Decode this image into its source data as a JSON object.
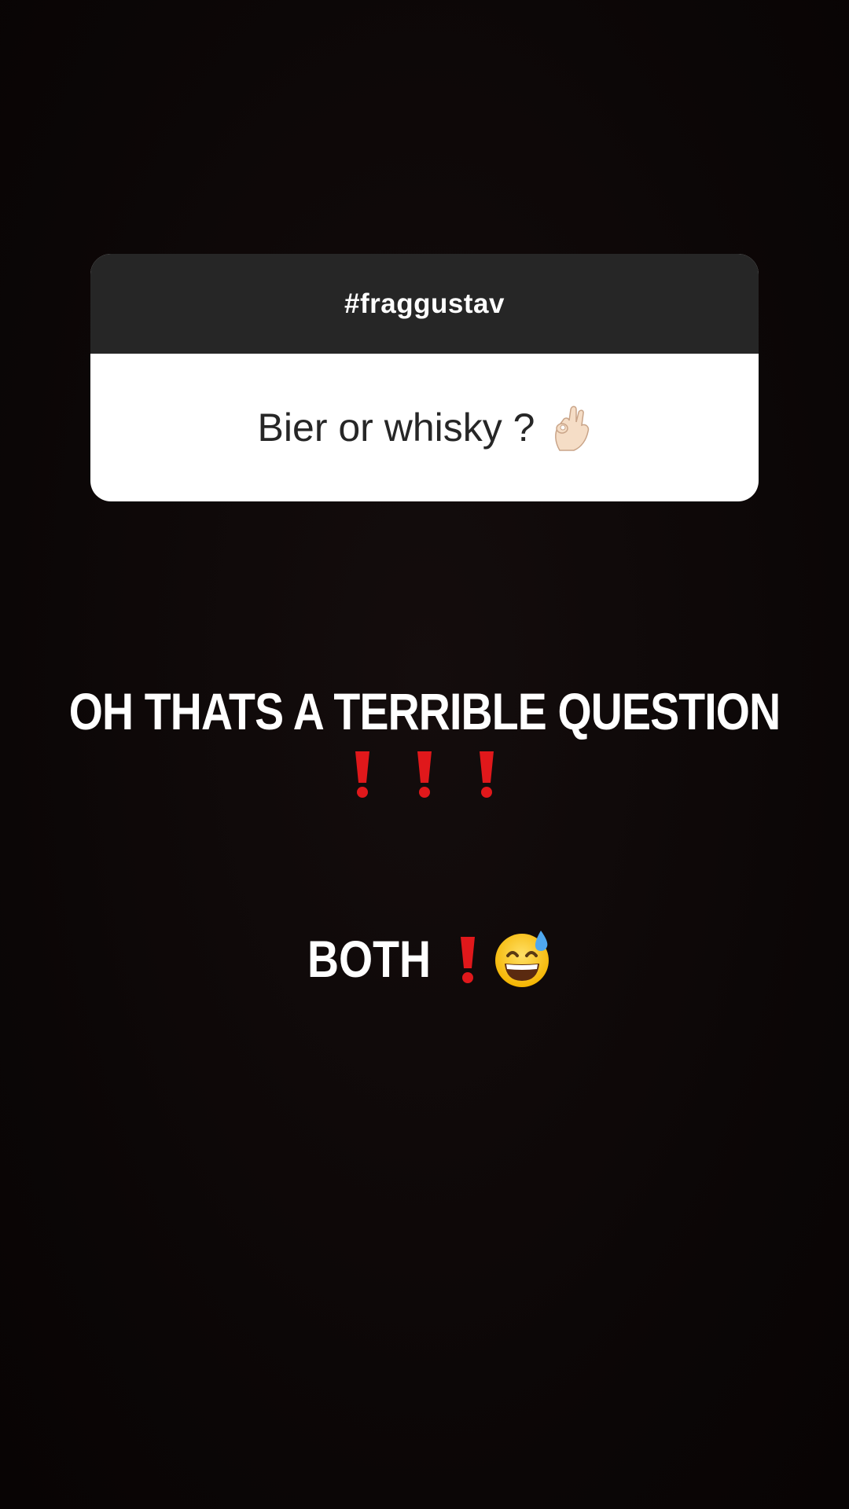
{
  "question_sticker": {
    "hashtag": "#fraggustav",
    "question": "Bier or whisky ?",
    "emoji_icon": "ok-hand-icon"
  },
  "captions": {
    "line1": "OH THATS A TERRIBLE QUESTION",
    "line1_emoji_icon": "exclamation-mark-icon",
    "line1_emoji_count": 3,
    "line2": "BOTH",
    "line2_emoji_icons": [
      "exclamation-mark-icon",
      "grinning-sweat-face-icon"
    ]
  },
  "colors": {
    "background": "#0b0606",
    "sticker_header": "#262626",
    "sticker_body": "#ffffff",
    "caption_text": "#ffffff",
    "exclamation_red": "#e0181b"
  }
}
